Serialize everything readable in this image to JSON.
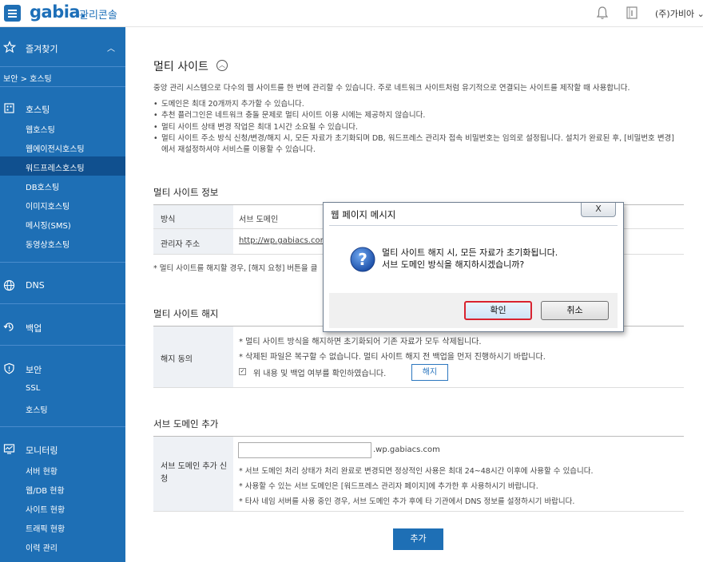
{
  "header": {
    "logo": "gabia.",
    "console_title": "관리콘솔",
    "user_menu": "(주)가비아",
    "icons": {
      "menu": "hamburger-icon",
      "notification": "bell-icon",
      "docs": "document-icon",
      "user_menu": "chevron-down-icon"
    }
  },
  "sidebar": {
    "favorites": {
      "label": "즐겨찾기",
      "chevron": "^"
    },
    "breadcrumb": "보안 > 호스팅",
    "groups": [
      {
        "label": "호스팅",
        "icon": "building-icon",
        "items": [
          "웹호스팅",
          "웹에이전시호스팅",
          "워드프레스호스팅",
          "DB호스팅",
          "이미지호스팅",
          "메시징(SMS)",
          "동영상호스팅"
        ],
        "active_index": 2
      },
      {
        "label": "DNS",
        "icon": "globe-icon",
        "items": []
      },
      {
        "label": "백업",
        "icon": "backup-icon",
        "items": []
      },
      {
        "label": "보안",
        "icon": "shield-icon",
        "items": [
          "SSL",
          "호스팅"
        ]
      },
      {
        "label": "모니터링",
        "icon": "monitor-icon",
        "items": [
          "서버 현황",
          "웹/DB 현황",
          "사이트 현황",
          "트래픽 현황",
          "이력 관리"
        ]
      }
    ]
  },
  "main": {
    "title": "멀티 사이트",
    "intro": "중앙 관리 시스템으로 다수의 웹 사이트를 한 번에 관리할 수 있습니다. 주로 네트워크 사이트처럼 유기적으로 연결되는 사이트를 제작할 때 사용합니다.",
    "bullets": [
      "도메인은 최대 20개까지 추가할 수 있습니다.",
      "추천 플러그인은 네트워크 충돌 문제로 멀티 사이트 이용 시에는 제공하지 않습니다.",
      "멀티 사이트 상태 변경 작업은 최대 1시간 소요될 수 있습니다.",
      "멀티 사이트 주소 방식 신청/변경/해지 시, 모든 자료가 초기화되며 DB, 워드프레스 관리자 접속 비밀번호는 임의로 설정됩니다. 설치가 완료된 후, [비밀번호 변경]에서 재설정하셔야 서비스를 이용할 수 있습니다."
    ],
    "info_section": {
      "title": "멀티 사이트 정보",
      "rows": [
        {
          "label": "방식",
          "value": "서브 도메인"
        },
        {
          "label": "관리자 주소",
          "value": "http://wp.gabiacs.com"
        }
      ],
      "note": "* 멀티 사이트를 해지할 경우, [해지 요청] 버튼을 클"
    },
    "cancel_section": {
      "title": "멀티 사이트 해지",
      "label": "해지 동의",
      "notes": [
        "* 멀티 사이트 방식을 해지하면 초기화되어 기존 자료가 모두 삭제됩니다.",
        "* 삭제된 파일은 복구할 수 없습니다. 멀티 사이트 해지 전 백업을 먼저 진행하시기 바랍니다."
      ],
      "checkbox_label": "위 내용 및 백업 여부를 확인하였습니다.",
      "cancel_button": "해지"
    },
    "subdomain_section": {
      "title": "서브 도메인 추가",
      "label": "서브 도메인 추가 신청",
      "input_value": "",
      "suffix": ".wp.gabiacs.com",
      "notes": [
        "* 서브 도메인 처리 상태가 처리 완료로 변경되면 정상적인 사용은 최대 24~48시간 이후에 사용할 수 있습니다.",
        "* 사용할 수 있는 서브 도메인은 [워드프레스 관리자 페이지]에 추가한 후 사용하시기 바랍니다.",
        "* 타사 네임 서버를 사용 중인 경우, 서브 도메인 추가 후에 타 기관에서 DNS 정보를 설정하시기 바랍니다."
      ],
      "add_button": "추가"
    }
  },
  "dialog": {
    "title": "웹 페이지 메시지",
    "close": "X",
    "message_line1": "멀티 사이트 해지 시, 모든 자료가 초기화됩니다.",
    "message_line2": "서브 도메인 방식을 해지하시겠습니까?",
    "ok_button": "확인",
    "cancel_button": "취소",
    "icon": "question-icon"
  }
}
